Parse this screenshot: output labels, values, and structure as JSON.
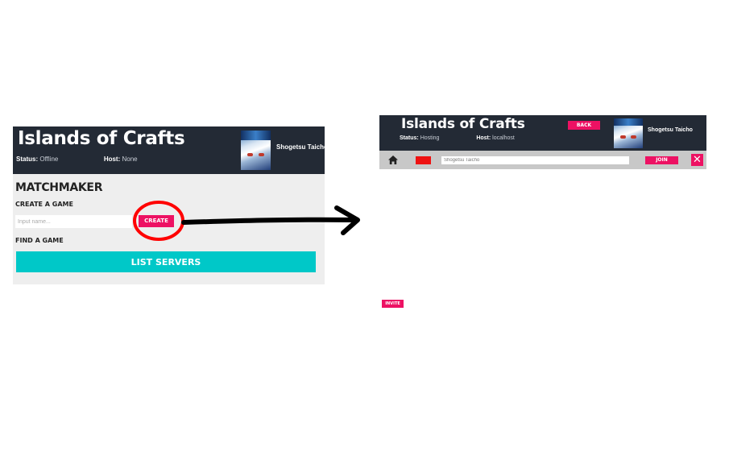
{
  "left_panel": {
    "header": {
      "title": "Islands of Crafts",
      "status_label": "Status:",
      "status_value": "Offline",
      "host_label": "Host:",
      "host_value": "None",
      "username": "Shogetsu Taicho"
    },
    "matchmaker": {
      "title": "MATCHMAKER",
      "create_heading": "CREATE A GAME",
      "input_placeholder": "Input name...",
      "create_label": "CREATE",
      "find_heading": "FIND A GAME",
      "list_servers_label": "LIST SERVERS"
    }
  },
  "annotation": {
    "circle_color": "#ff0000",
    "arrow_color": "#000000"
  },
  "right_panel": {
    "header": {
      "title": "Islands of Crafts",
      "status_label": "Status:",
      "status_value": "Hosting",
      "host_label": "Host:",
      "host_value": "localhost",
      "back_label": "BACK",
      "username": "Shogetsu Taicho"
    },
    "toolbar": {
      "home_icon": "home-icon",
      "color_swatch": "#ee1111",
      "name_value": "Shogetsu Taicho",
      "join_label": "JOIN",
      "close_icon": "close-icon"
    },
    "invite_label": "INVITE"
  },
  "colors": {
    "header_bg": "#232a35",
    "accent_pink": "#ed1163",
    "accent_cyan": "#00c8c8",
    "body_bg": "#eeeeee",
    "toolbar_bg": "#c8c8c8"
  }
}
